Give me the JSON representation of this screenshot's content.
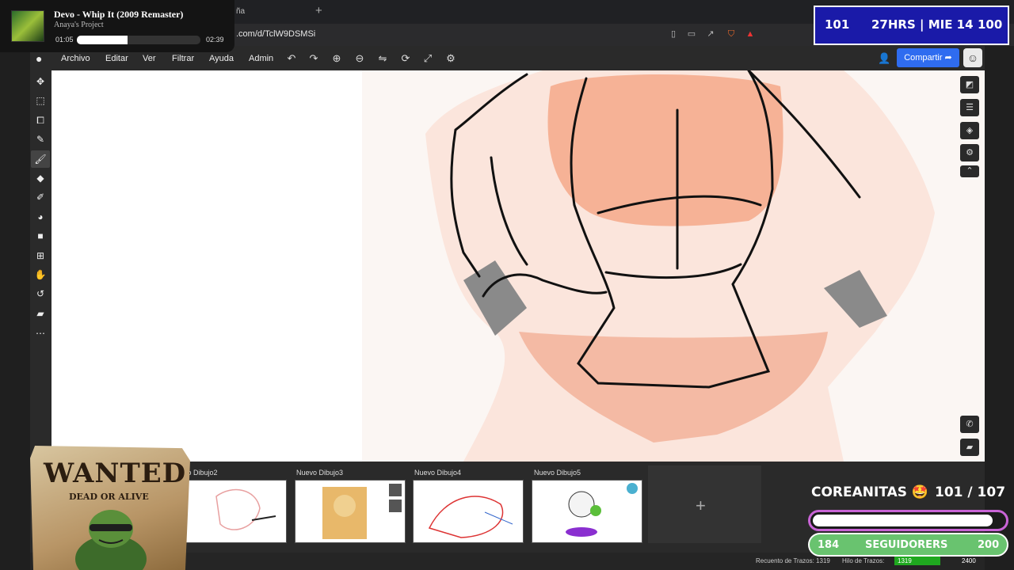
{
  "browser": {
    "tab_fragment": "ña",
    "new_tab": "+",
    "url": ".com/d/TclW9DSMSi"
  },
  "now_playing": {
    "title": "Devo - Whip It (2009 Remaster)",
    "artist": "Anaya's Project",
    "elapsed": "01:05",
    "duration": "02:39",
    "progress_fraction": 0.41
  },
  "stream_stats": {
    "left_value": "101",
    "center_text": "27HRS | MIE 14",
    "right_value": "100"
  },
  "menu": {
    "items": [
      "Archivo",
      "Editar",
      "Ver",
      "Filtrar",
      "Ayuda",
      "Admin"
    ],
    "share_label": "Compartir"
  },
  "toolbar_icons": [
    "undo-icon",
    "redo-icon",
    "zoom-in-icon",
    "zoom-out-icon",
    "flip-icon",
    "rotate-icon",
    "fullscreen-icon",
    "settings-icon"
  ],
  "left_tools": [
    "move-icon",
    "select-rect-icon",
    "transform-icon",
    "eyedropper-icon",
    "brush-icon",
    "eraser-icon",
    "smudge-icon",
    "fill-icon",
    "shape-icon",
    "add-icon",
    "hand-icon",
    "history-icon",
    "comment-icon",
    "more-icon"
  ],
  "gallery": {
    "items": [
      {
        "label": "vo Dibujo2"
      },
      {
        "label": "Nuevo Dibujo3"
      },
      {
        "label": "Nuevo Dibujo4"
      },
      {
        "label": "Nuevo Dibujo5"
      }
    ],
    "add_label": "+"
  },
  "status": {
    "strokes_label": "Recuento de Trazos: 1319",
    "line_label": "Hilo de Trazos:",
    "line_value": "1319",
    "max_value": "2400"
  },
  "wanted_poster": {
    "title": "WANTED",
    "subtitle": "DEAD OR ALIVE"
  },
  "follower_goal": {
    "label": "COREANITAS 🤩",
    "count": "101  / 107",
    "fraction": 0.94,
    "followers_start": "184",
    "followers_label": "SEGUIDORERS",
    "followers_goal": "200"
  }
}
